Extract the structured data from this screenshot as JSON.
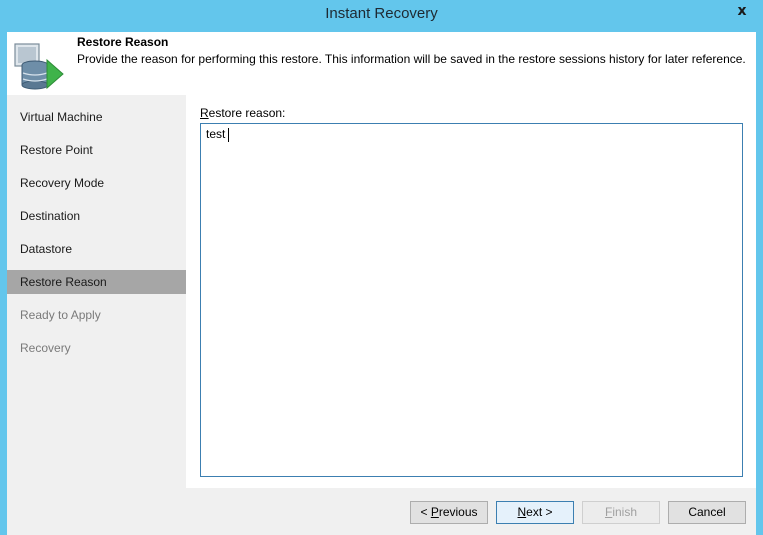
{
  "window": {
    "title": "Instant Recovery",
    "close_glyph": "x"
  },
  "header": {
    "title": "Restore Reason",
    "description": "Provide the reason for performing this restore. This information will be saved in the restore sessions history for later reference.",
    "icon": "database-arrow-icon"
  },
  "steps": [
    {
      "label": "Virtual Machine",
      "state": "normal"
    },
    {
      "label": "Restore Point",
      "state": "normal"
    },
    {
      "label": "Recovery Mode",
      "state": "normal"
    },
    {
      "label": "Destination",
      "state": "normal"
    },
    {
      "label": "Datastore",
      "state": "normal"
    },
    {
      "label": "Restore Reason",
      "state": "active"
    },
    {
      "label": "Ready to Apply",
      "state": "disabled"
    },
    {
      "label": "Recovery",
      "state": "disabled"
    }
  ],
  "form": {
    "label_accel": "R",
    "label_rest": "estore reason:",
    "value": "test"
  },
  "buttons": {
    "previous_pre": "< ",
    "previous_accel": "P",
    "previous_rest": "revious",
    "next_accel": "N",
    "next_rest": "ext >",
    "finish_accel": "F",
    "finish_rest": "inish",
    "cancel": "Cancel"
  },
  "colors": {
    "titlebar": "#63c6ec",
    "active_step": "#a6a6a6",
    "focus_border": "#3c7fb1"
  }
}
